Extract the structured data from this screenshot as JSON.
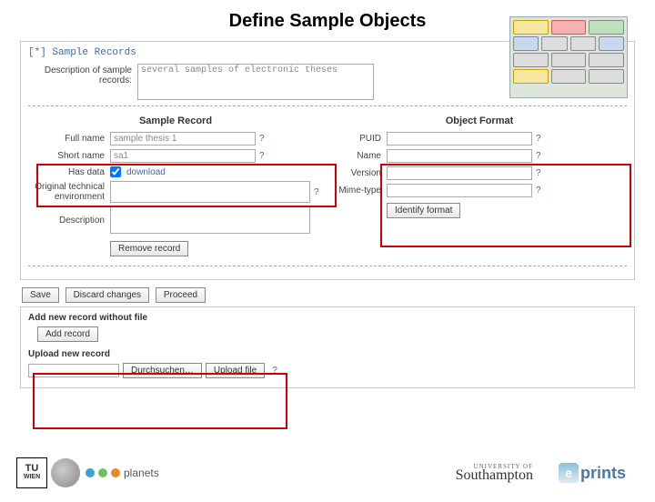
{
  "title": "Define Sample Objects",
  "records": {
    "header": "[*] Sample Records",
    "desc_label": "Description of sample records:",
    "desc_value": "several samples of electronic theses"
  },
  "sample_record": {
    "title": "Sample Record",
    "full_name_label": "Full name",
    "full_name_value": "sample thesis 1",
    "short_name_label": "Short name",
    "short_name_value": "sa1",
    "has_data_label": "Has data",
    "download_label": "download",
    "env_label": "Original technical environment",
    "desc_label": "Description",
    "remove_label": "Remove record"
  },
  "object_format": {
    "title": "Object Format",
    "puid_label": "PUID",
    "name_label": "Name",
    "version_label": "Version",
    "mime_label": "Mime-type",
    "identify_label": "Identify format"
  },
  "actions": {
    "save": "Save",
    "discard": "Discard changes",
    "proceed": "Proceed"
  },
  "add": {
    "without_file": "Add new record without file",
    "add_record": "Add record",
    "upload_new": "Upload new record",
    "browse": "Durchsuchen…",
    "upload": "Upload file"
  },
  "logos": {
    "tu_top": "TU",
    "tu_bottom": "WIEN",
    "planets": "planets",
    "soton_small": "UNIVERSITY OF",
    "soton": "Southampton",
    "eprints": "prints"
  }
}
